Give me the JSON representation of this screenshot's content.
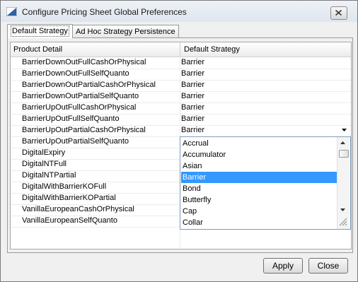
{
  "window": {
    "title": "Configure Pricing Sheet Global Preferences"
  },
  "tabs": [
    {
      "label": "Default Strategy"
    },
    {
      "label": "Ad Hoc Strategy Persistence"
    }
  ],
  "table": {
    "columns": [
      "Product Detail",
      "Default Strategy"
    ],
    "rows": [
      {
        "product": "BarrierDownOutFullCashOrPhysical",
        "strategy": "Barrier"
      },
      {
        "product": "BarrierDownOutFullSelfQuanto",
        "strategy": "Barrier"
      },
      {
        "product": "BarrierDownOutPartialCashOrPhysical",
        "strategy": "Barrier"
      },
      {
        "product": "BarrierDownOutPartialSelfQuanto",
        "strategy": "Barrier"
      },
      {
        "product": "BarrierUpOutFullCashOrPhysical",
        "strategy": "Barrier"
      },
      {
        "product": "BarrierUpOutFullSelfQuanto",
        "strategy": "Barrier"
      },
      {
        "product": "BarrierUpOutPartialCashOrPhysical",
        "strategy": "Barrier"
      },
      {
        "product": "BarrierUpOutPartialSelfQuanto",
        "strategy": ""
      },
      {
        "product": "DigitalExpiry",
        "strategy": ""
      },
      {
        "product": "DigitalNTFull",
        "strategy": ""
      },
      {
        "product": "DigitalNTPartial",
        "strategy": ""
      },
      {
        "product": "DigitalWithBarrierKOFull",
        "strategy": ""
      },
      {
        "product": "DigitalWithBarrierKOPartial",
        "strategy": ""
      },
      {
        "product": "VanillaEuropeanCashOrPhysical",
        "strategy": ""
      },
      {
        "product": "VanillaEuropeanSelfQuanto",
        "strategy": ""
      }
    ]
  },
  "dropdown": {
    "options": [
      "Accrual",
      "Accumulator",
      "Asian",
      "Barrier",
      "Bond",
      "Butterfly",
      "Cap",
      "Collar"
    ],
    "selected": "Barrier"
  },
  "buttons": {
    "apply": "Apply",
    "close": "Close"
  },
  "colors": {
    "selection": "#3399ff",
    "titlebar": "#dfe6ef"
  }
}
